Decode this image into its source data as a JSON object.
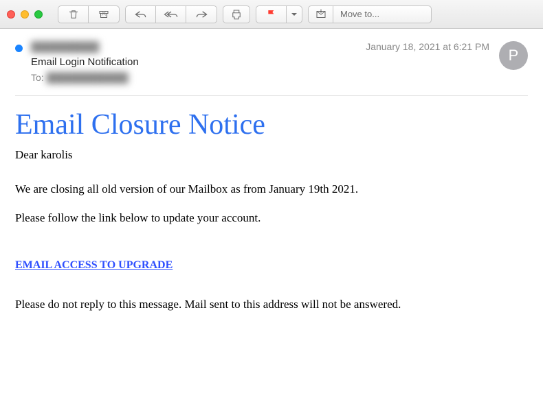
{
  "toolbar": {
    "move_to_label": "Move to..."
  },
  "email": {
    "from": "██████████",
    "subject": "Email Login Notification",
    "to_label": "To:",
    "to_value": "████████████",
    "date": "January 18, 2021 at 6:21 PM",
    "avatar_initial": "P"
  },
  "body": {
    "title": "Email Closure Notice",
    "greeting": "Dear karolis",
    "para1": "We are closing all old version of our Mailbox as from January 19th 2021.",
    "para2": "Please follow the link below to update your account.",
    "link_text": "EMAIL ACCESS TO UPGRADE",
    "footer": "Please do not reply to this message. Mail sent to this address will not be answered."
  }
}
